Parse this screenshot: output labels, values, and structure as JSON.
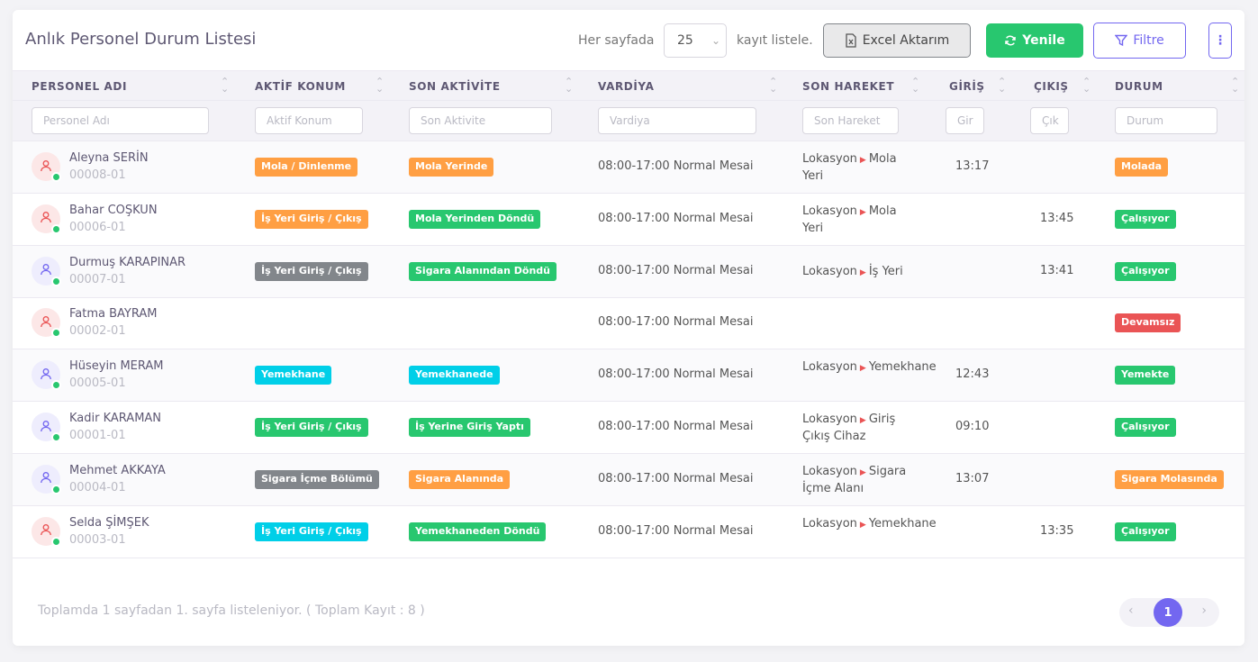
{
  "header": {
    "title": "Anlık Personel Durum Listesi",
    "per_page_label": "Her sayfada",
    "per_page_value": "25",
    "per_page_suffix": "kayıt listele.",
    "excel_label": "Excel Aktarım",
    "refresh_label": "Yenile",
    "filter_label": "Filtre"
  },
  "columns": [
    "PERSONEL ADI",
    "AKTİF KONUM",
    "SON AKTİVİTE",
    "VARDİYA",
    "SON HAREKET",
    "GİRİŞ",
    "ÇIKIŞ",
    "DURUM"
  ],
  "filters": {
    "name": "Personel Adı",
    "location": "Aktif Konum",
    "activity": "Son Aktivite",
    "shift": "Vardiya",
    "movement": "Son Hareket",
    "in": "Gir",
    "out": "Çık",
    "status": "Durum"
  },
  "rows": [
    {
      "name": "Aleyna SERİN",
      "code": "00008-01",
      "avatar": "red",
      "location": "Mola / Dinlenme",
      "location_color": "orange",
      "activity": "Mola Yerinde",
      "activity_color": "orange",
      "shift": "08:00-17:00 Normal Mesai",
      "move_from": "Lokasyon",
      "move_to": "Mola Yeri",
      "in": "13:17",
      "out": "",
      "status": "Molada",
      "status_color": "orange"
    },
    {
      "name": "Bahar COŞKUN",
      "code": "00006-01",
      "avatar": "red",
      "location": "İş Yeri Giriş / Çıkış",
      "location_color": "orange",
      "activity": "Mola Yerinden Döndü",
      "activity_color": "green",
      "shift": "08:00-17:00 Normal Mesai",
      "move_from": "Lokasyon",
      "move_to": "Mola Yeri",
      "in": "",
      "out": "13:45",
      "status": "Çalışıyor",
      "status_color": "green"
    },
    {
      "name": "Durmuş KARAPINAR",
      "code": "00007-01",
      "avatar": "purple",
      "location": "İş Yeri Giriş / Çıkış",
      "location_color": "gray",
      "activity": "Sigara Alanından Döndü",
      "activity_color": "green",
      "shift": "08:00-17:00 Normal Mesai",
      "move_from": "Lokasyon",
      "move_to": "İş Yeri",
      "in": "",
      "out": "13:41",
      "status": "Çalışıyor",
      "status_color": "green"
    },
    {
      "name": "Fatma BAYRAM",
      "code": "00002-01",
      "avatar": "red",
      "location": "",
      "location_color": "",
      "activity": "",
      "activity_color": "",
      "shift": "08:00-17:00 Normal Mesai",
      "move_from": "",
      "move_to": "",
      "in": "",
      "out": "",
      "status": "Devamsız",
      "status_color": "red"
    },
    {
      "name": "Hüseyin MERAM",
      "code": "00005-01",
      "avatar": "purple",
      "location": "Yemekhane",
      "location_color": "cyan",
      "activity": "Yemekhanede",
      "activity_color": "cyan",
      "shift": "08:00-17:00 Normal Mesai",
      "move_from": "Lokasyon",
      "move_to": "Yemekhane",
      "in": "12:43",
      "out": "",
      "status": "Yemekte",
      "status_color": "green"
    },
    {
      "name": "Kadir KARAMAN",
      "code": "00001-01",
      "avatar": "purple",
      "location": "İş Yeri Giriş / Çıkış",
      "location_color": "green",
      "activity": "İş Yerine Giriş Yaptı",
      "activity_color": "green",
      "shift": "08:00-17:00 Normal Mesai",
      "move_from": "Lokasyon",
      "move_to": "Giriş Çıkış Cihaz",
      "in": "09:10",
      "out": "",
      "status": "Çalışıyor",
      "status_color": "green"
    },
    {
      "name": "Mehmet AKKAYA",
      "code": "00004-01",
      "avatar": "purple",
      "location": "Sigara İçme Bölümü",
      "location_color": "gray",
      "activity": "Sigara Alanında",
      "activity_color": "orange",
      "shift": "08:00-17:00 Normal Mesai",
      "move_from": "Lokasyon",
      "move_to": "Sigara İçme Alanı",
      "in": "13:07",
      "out": "",
      "status": "Sigara Molasında",
      "status_color": "orange"
    },
    {
      "name": "Selda ŞİMŞEK",
      "code": "00003-01",
      "avatar": "red",
      "location": "İş Yeri Giriş / Çıkış",
      "location_color": "cyan",
      "activity": "Yemekhaneden Döndü",
      "activity_color": "green",
      "shift": "08:00-17:00 Normal Mesai",
      "move_from": "Lokasyon",
      "move_to": "Yemekhane",
      "in": "",
      "out": "13:35",
      "status": "Çalışıyor",
      "status_color": "green"
    }
  ],
  "footer": {
    "summary": "Toplamda 1 sayfadan 1. sayfa listeleniyor. ( Toplam Kayıt : 8 )",
    "prev": "‹",
    "current_page": "1",
    "next": "›"
  },
  "colors": {
    "primary": "#7367f0",
    "success": "#28c76f",
    "warning": "#ff9f43",
    "danger": "#ea5455",
    "info": "#00cfe8",
    "secondary": "#82868b"
  }
}
